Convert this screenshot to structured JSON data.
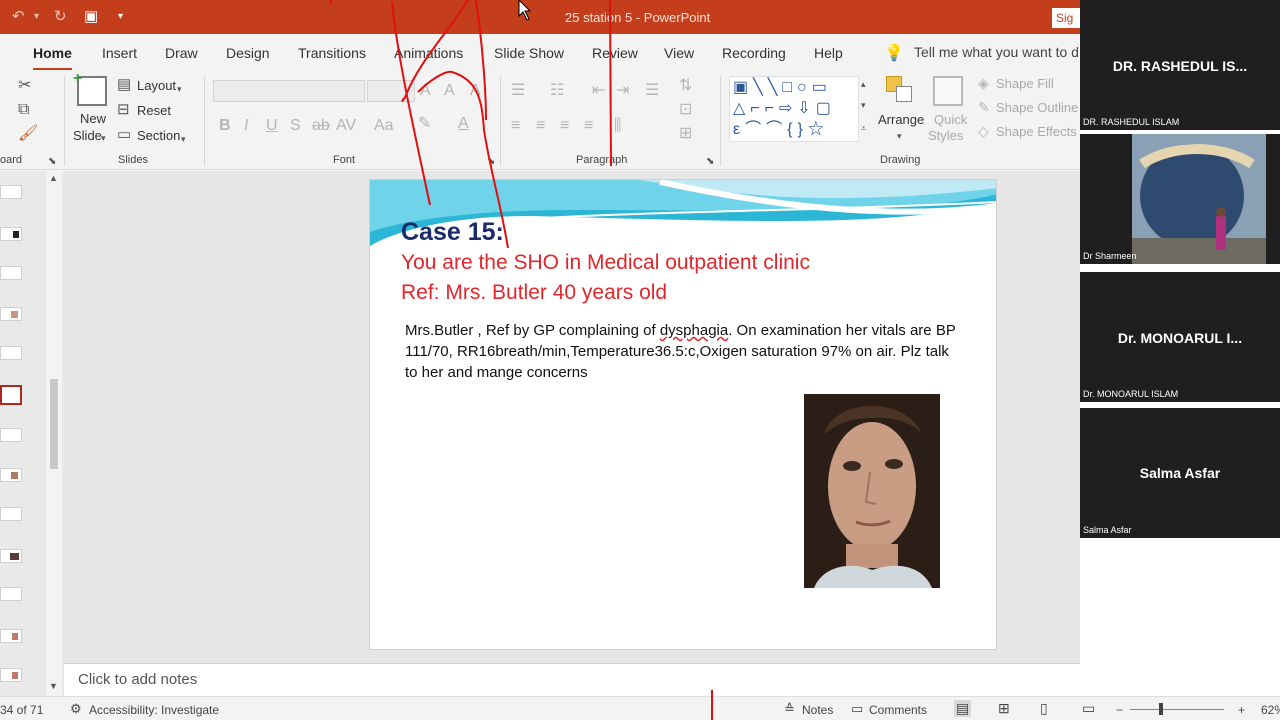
{
  "window": {
    "title": "25 station 5  -  PowerPoint",
    "signin": "Sig"
  },
  "tabs": [
    "Home",
    "Insert",
    "Draw",
    "Design",
    "Transitions",
    "Animations",
    "Slide Show",
    "Review",
    "View",
    "Recording",
    "Help"
  ],
  "tellme": "Tell me what you want to d",
  "ribbon": {
    "clipboard_label": "oard",
    "new_slide": "New",
    "new_slide_2": "Slide",
    "layout": "Layout",
    "reset": "Reset",
    "section": "Section",
    "slides_label": "Slides",
    "font_label": "Font",
    "paragraph_label": "Paragraph",
    "arrange": "Arrange",
    "quick_styles": "Quick",
    "quick_styles_2": "Styles",
    "shape_fill": "Shape Fill",
    "shape_outline": "Shape Outline",
    "shape_effects": "Shape Effects",
    "drawing_label": "Drawing"
  },
  "slide": {
    "heading": "Case 15:",
    "line1": "You are the SHO in Medical outpatient clinic",
    "line2": "Ref: Mrs. Butler 40 years old",
    "body_a": "Mrs.Butler , Ref by GP complaining of ",
    "body_keyword": "dysphagia",
    "body_b": ". On examination her vitals are BP 111/70, RR16breath/min,Temperature36.5:c,Oxigen saturation 97% on air. Plz talk to her and mange concerns"
  },
  "notes_placeholder": "Click to add notes",
  "status": {
    "slide_count": "34 of 71",
    "accessibility": "Accessibility: Investigate",
    "notes": "Notes",
    "comments": "Comments",
    "zoom": "62%"
  },
  "participants": [
    {
      "display": "DR. RASHEDUL IS...",
      "label": "DR. RASHEDUL ISLAM"
    },
    {
      "label": "Dr Sharmeen"
    },
    {
      "display": "Dr. MONOARUL I...",
      "label": "Dr. MONOARUL ISLAM"
    },
    {
      "display": "Salma Asfar",
      "label": "Salma Asfar"
    }
  ],
  "colors": {
    "brand": "#c43e1c",
    "slide_heading": "#1a2a6c",
    "slide_accent": "#e2262c",
    "ink": "#e01010"
  }
}
